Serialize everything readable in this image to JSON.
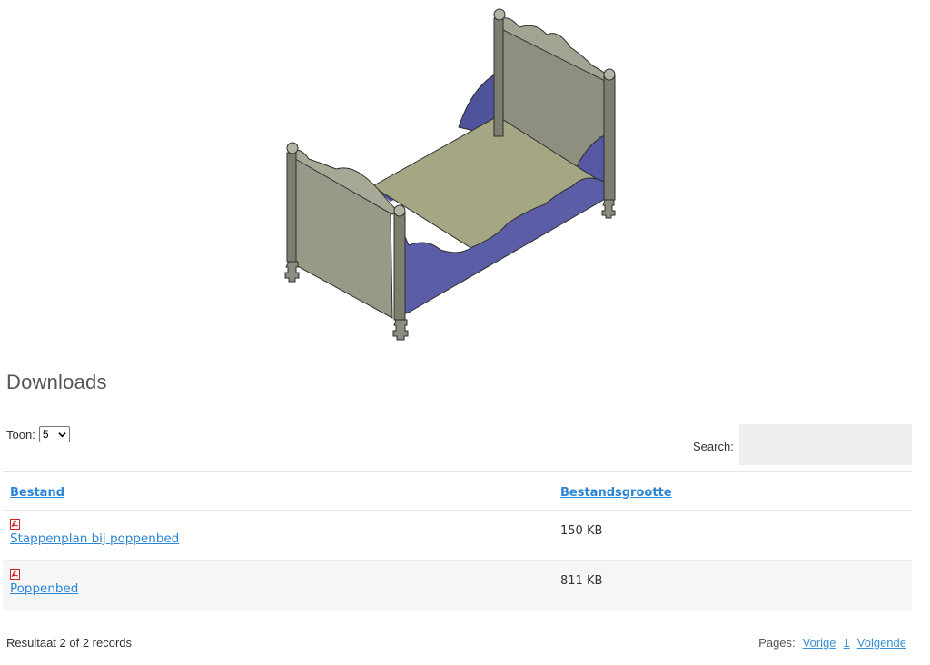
{
  "downloads": {
    "title": "Downloads",
    "toon_label": "Toon:",
    "toon_value": "5",
    "search_label": "Search:",
    "search_value": "",
    "columns": {
      "file": "Bestand",
      "size": "Bestandsgrootte"
    },
    "rows": [
      {
        "name": "Stappenplan bij poppenbed",
        "size": "150 KB",
        "icon": "pdf-icon"
      },
      {
        "name": "Poppenbed",
        "size": "811 KB",
        "icon": "pdf-icon"
      }
    ],
    "result_text": "Resultaat 2 of 2 records",
    "pagination": {
      "label": "Pages:",
      "prev": "Vorige",
      "current": "1",
      "next": "Volgende"
    }
  },
  "colors": {
    "link": "#2a86d6",
    "bed_side": "#5b5ea6",
    "bed_panel": "#9a9a86",
    "bed_mattress": "#a6a784"
  }
}
